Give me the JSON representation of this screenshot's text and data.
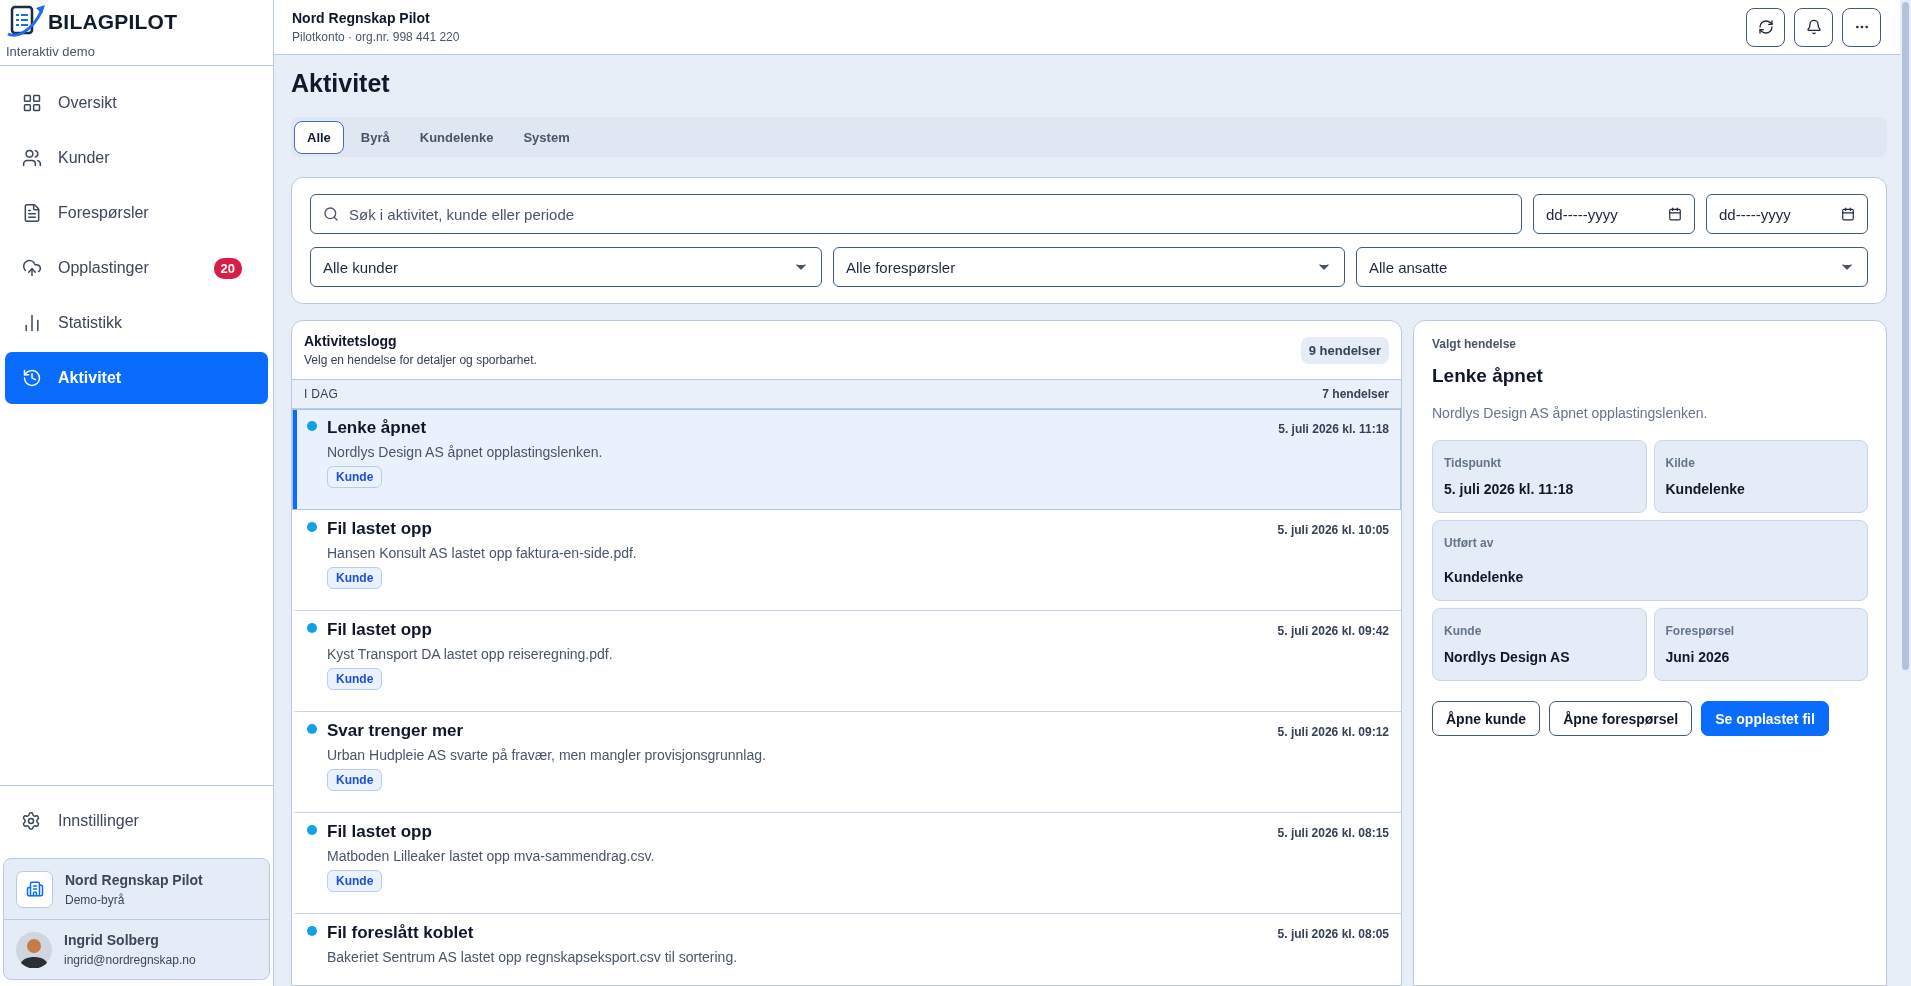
{
  "brand": {
    "name": "BILAGPILOT",
    "subtitle": "Interaktiv demo"
  },
  "nav": [
    {
      "label": "Oversikt",
      "selected": false
    },
    {
      "label": "Kunder",
      "selected": false
    },
    {
      "label": "Forespørsler",
      "selected": false
    },
    {
      "label": "Opplastinger",
      "selected": false,
      "badge": "20"
    },
    {
      "label": "Statistikk",
      "selected": false
    },
    {
      "label": "Aktivitet",
      "selected": true
    }
  ],
  "settings": {
    "label": "Innstillinger"
  },
  "org_card": {
    "name": "Nord Regnskap Pilot",
    "subtitle": "Demo-byrå"
  },
  "user_card": {
    "name": "Ingrid Solberg",
    "email": "ingrid@nordregnskap.no"
  },
  "header": {
    "title": "Nord Regnskap Pilot",
    "subtitle": "Pilotkonto · org.nr. 998 441 220"
  },
  "page_title": "Aktivitet",
  "tabs": [
    {
      "label": "Alle",
      "selected": true
    },
    {
      "label": "Byrå",
      "selected": false
    },
    {
      "label": "Kundelenke",
      "selected": false
    },
    {
      "label": "System",
      "selected": false
    }
  ],
  "filters": {
    "search": {
      "placeholder": "Søk i aktivitet, kunde eller periode"
    },
    "dates": [
      {
        "placeholder": "dd-----yyyy"
      },
      {
        "placeholder": "dd-----yyyy"
      }
    ],
    "selects": [
      {
        "value": "Alle kunder"
      },
      {
        "value": "Alle forespørsler"
      },
      {
        "value": "Alle ansatte"
      }
    ]
  },
  "log": {
    "title": "Aktivitetslogg",
    "subtitle": "Velg en hendelse for detaljer og sporbarhet.",
    "count": "9 hendelser",
    "groups": [
      {
        "label": "I DAG",
        "count": "7 hendelser",
        "events": [
          {
            "title": "Lenke åpnet",
            "description": "Nordlys Design AS åpnet opplastingslenken.",
            "time": "5. juli 2026 kl. 11:18",
            "tag": "Kunde",
            "selected": true
          },
          {
            "title": "Fil lastet opp",
            "description": "Hansen Konsult AS lastet opp faktura-en-side.pdf.",
            "time": "5. juli 2026 kl. 10:05",
            "tag": "Kunde",
            "selected": false
          },
          {
            "title": "Fil lastet opp",
            "description": "Kyst Transport DA lastet opp reiseregning.pdf.",
            "time": "5. juli 2026 kl. 09:42",
            "tag": "Kunde",
            "selected": false
          },
          {
            "title": "Svar trenger mer",
            "description": "Urban Hudpleie AS svarte på fravær, men mangler provisjonsgrunnlag.",
            "time": "5. juli 2026 kl. 09:12",
            "tag": "Kunde",
            "selected": false
          },
          {
            "title": "Fil lastet opp",
            "description": "Matboden Lilleaker lastet opp mva-sammendrag.csv.",
            "time": "5. juli 2026 kl. 08:15",
            "tag": "Kunde",
            "selected": false
          },
          {
            "title": "Fil foreslått koblet",
            "description": "Bakeriet Sentrum AS lastet opp regnskapseksport.csv til sortering.",
            "time": "5. juli 2026 kl. 08:05",
            "selected": false
          }
        ]
      }
    ]
  },
  "detail": {
    "eyebrow": "Valgt hendelse",
    "title": "Lenke åpnet",
    "description": "Nordlys Design AS åpnet opplastingslenken.",
    "fields": [
      {
        "label": "Tidspunkt",
        "value": "5. juli 2026 kl. 11:18",
        "wide": false
      },
      {
        "label": "Kilde",
        "value": "Kundelenke",
        "wide": false
      },
      {
        "label": "Utført av",
        "value": "Kundelenke",
        "wide": true
      },
      {
        "label": "Kunde",
        "value": "Nordlys Design AS",
        "wide": false
      },
      {
        "label": "Forespørsel",
        "value": "Juni 2026",
        "wide": false
      }
    ],
    "buttons": [
      {
        "label": "Åpne kunde",
        "kind": "secondary"
      },
      {
        "label": "Åpne forespørsel",
        "kind": "secondary"
      },
      {
        "label": "Se opplastet fil",
        "kind": "primary"
      }
    ]
  }
}
